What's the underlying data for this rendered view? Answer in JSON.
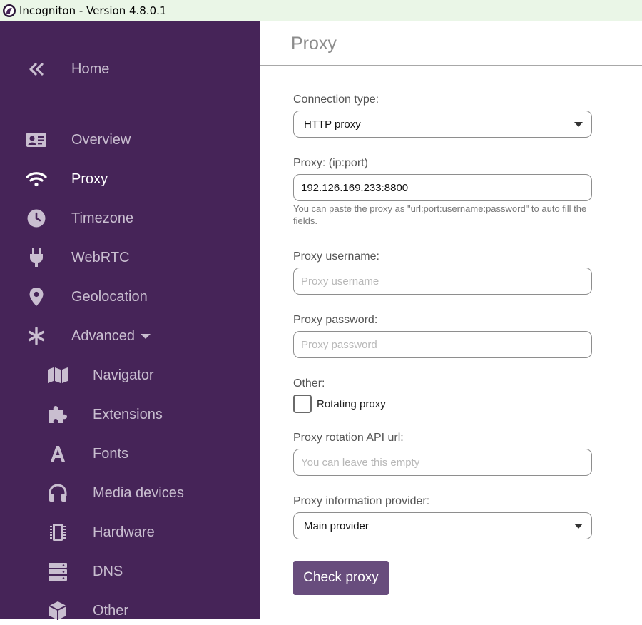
{
  "window": {
    "title": "Incogniton - Version 4.8.0.1"
  },
  "sidebar": {
    "home": {
      "label": "Home",
      "icon": "double-chevron-left-icon"
    },
    "items": [
      {
        "label": "Overview",
        "icon": "id-card-icon",
        "active": false
      },
      {
        "label": "Proxy",
        "icon": "wifi-icon",
        "active": true
      },
      {
        "label": "Timezone",
        "icon": "clock-icon",
        "active": false
      },
      {
        "label": "WebRTC",
        "icon": "plug-icon",
        "active": false
      },
      {
        "label": "Geolocation",
        "icon": "map-pin-icon",
        "active": false
      },
      {
        "label": "Advanced",
        "icon": "asterisk-icon",
        "active": false,
        "expanded": true
      }
    ],
    "sub_items": [
      {
        "label": "Navigator",
        "icon": "map-icon"
      },
      {
        "label": "Extensions",
        "icon": "puzzle-icon"
      },
      {
        "label": "Fonts",
        "icon": "font-icon"
      },
      {
        "label": "Media devices",
        "icon": "headphones-icon"
      },
      {
        "label": "Hardware",
        "icon": "chip-icon"
      },
      {
        "label": "DNS",
        "icon": "server-icon"
      },
      {
        "label": "Other",
        "icon": "box-icon"
      }
    ]
  },
  "main": {
    "title": "Proxy",
    "connection_type": {
      "label": "Connection type:",
      "value": "HTTP proxy"
    },
    "proxy": {
      "label": "Proxy: (ip:port)",
      "value": "192.126.169.233:8800",
      "hint": "You can paste the proxy as \"url:port:username:password\" to auto fill the fields."
    },
    "username": {
      "label": "Proxy username:",
      "placeholder": "Proxy username"
    },
    "password": {
      "label": "Proxy password:",
      "placeholder": "Proxy password"
    },
    "other": {
      "label": "Other:",
      "rotating_label": "Rotating proxy",
      "rotating_checked": false
    },
    "rotation_api": {
      "label": "Proxy rotation API url:",
      "placeholder": "You can leave this empty"
    },
    "info_provider": {
      "label": "Proxy information provider:",
      "value": "Main provider"
    },
    "check_button": "Check proxy"
  },
  "colors": {
    "sidebar_bg": "#462458",
    "sidebar_text": "#c9bed0",
    "sidebar_active": "#ffffff",
    "button_bg": "#684d7d",
    "titlebar_bg": "#eaf6e7"
  }
}
